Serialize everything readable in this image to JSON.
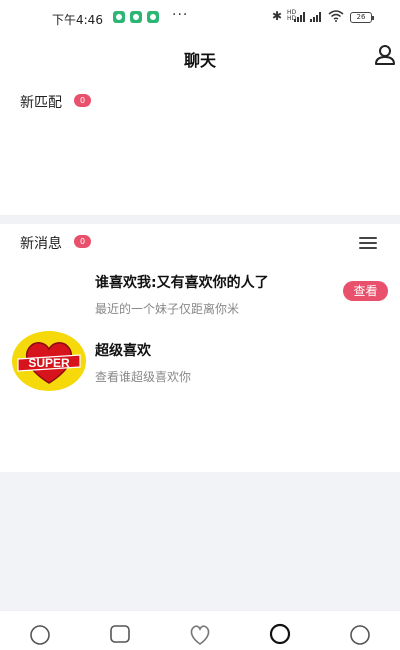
{
  "status_bar": {
    "time": "下午4:46",
    "dots": "···",
    "battery": "26"
  },
  "header": {
    "title": "聊天"
  },
  "new_matches": {
    "label": "新匹配",
    "count": "0"
  },
  "new_messages": {
    "label": "新消息",
    "count": "0"
  },
  "messages": [
    {
      "title": "谁喜欢我:又有喜欢你的人了",
      "subtitle": "最近的一个妹子仅距离你米",
      "action_label": "查看"
    },
    {
      "title": "超级喜欢",
      "subtitle": "查看谁超级喜欢你",
      "logo_text": "SUPER"
    }
  ],
  "colors": {
    "accent": "#e8506b",
    "notif_green": "#2bb673",
    "super_yellow": "#f5d90a",
    "super_red": "#d7141c"
  },
  "tabs": [
    {
      "icon": "circle-icon"
    },
    {
      "icon": "chat-square-icon"
    },
    {
      "icon": "heart-icon"
    },
    {
      "icon": "message-active-icon"
    },
    {
      "icon": "profile-circle-icon"
    }
  ]
}
